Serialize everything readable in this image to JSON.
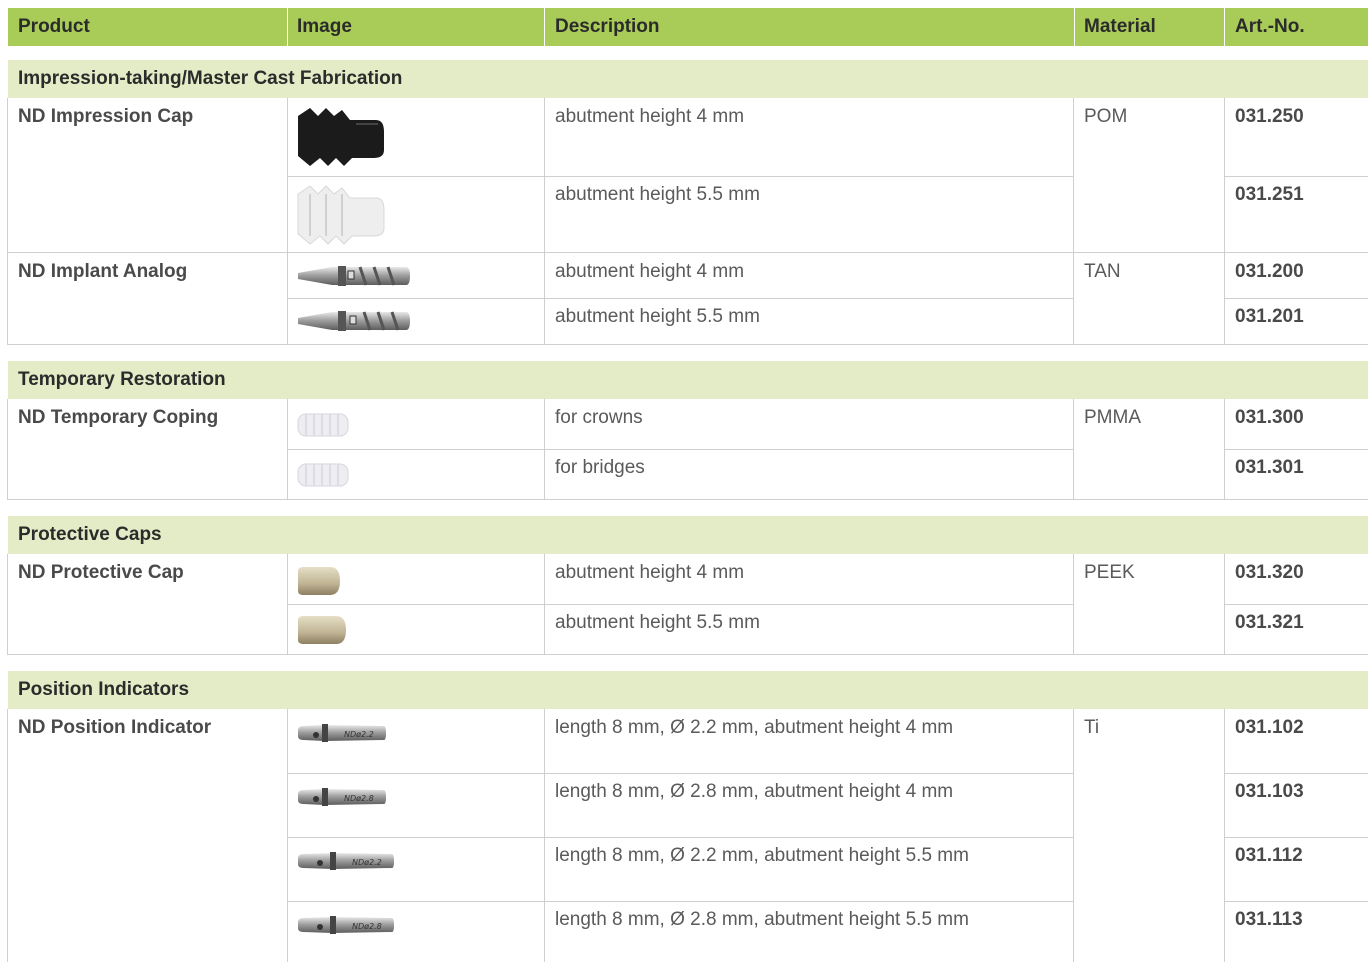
{
  "header": {
    "product": "Product",
    "image": "Image",
    "description": "Description",
    "material": "Material",
    "artno": "Art.-No."
  },
  "sections": [
    {
      "title": "Impression-taking/Master Cast Fabrication",
      "products": [
        {
          "name": "ND Impression Cap",
          "material": "POM",
          "rows": [
            {
              "description": "abutment height 4 mm",
              "art": "031.250",
              "image": "black-impression-cap"
            },
            {
              "description": "abutment height 5.5 mm",
              "art": "031.251",
              "image": "white-impression-cap"
            }
          ]
        },
        {
          "name": "ND Implant Analog",
          "material": "TAN",
          "rows": [
            {
              "description": "abutment height 4 mm",
              "art": "031.200",
              "image": "implant-analog"
            },
            {
              "description": "abutment height 5.5 mm",
              "art": "031.201",
              "image": "implant-analog"
            }
          ]
        }
      ]
    },
    {
      "title": "Temporary Restoration",
      "products": [
        {
          "name": "ND Temporary Coping",
          "material": "PMMA",
          "rows": [
            {
              "description": "for crowns",
              "art": "031.300",
              "image": "temporary-coping"
            },
            {
              "description": "for bridges",
              "art": "031.301",
              "image": "temporary-coping"
            }
          ]
        }
      ]
    },
    {
      "title": "Protective Caps",
      "products": [
        {
          "name": "ND Protective Cap",
          "material": "PEEK",
          "rows": [
            {
              "description": "abutment height 4 mm",
              "art": "031.320",
              "image": "protective-cap"
            },
            {
              "description": "abutment height 5.5 mm",
              "art": "031.321",
              "image": "protective-cap"
            }
          ]
        }
      ]
    },
    {
      "title": "Position Indicators",
      "products": [
        {
          "name": "ND Position Indicator",
          "material": "Ti",
          "rows": [
            {
              "description": "length 8 mm, Ø 2.2 mm, abutment height 4 mm",
              "art": "031.102",
              "image": "position-indicator",
              "engraving": "NDø2.2"
            },
            {
              "description": "length 8 mm, Ø 2.8 mm, abutment height 4 mm",
              "art": "031.103",
              "image": "position-indicator",
              "engraving": "NDø2.8"
            },
            {
              "description": "length 8 mm, Ø 2.2 mm, abutment height 5.5 mm",
              "art": "031.112",
              "image": "position-indicator",
              "engraving": "NDø2.2"
            },
            {
              "description": "length 8 mm, Ø 2.8 mm, abutment height 5.5 mm",
              "art": "031.113",
              "image": "position-indicator",
              "engraving": "NDø2.8"
            }
          ]
        }
      ]
    }
  ],
  "colors": {
    "header_bg": "#a9cc58",
    "section_bg": "#e3ecc6",
    "grid": "#cfcfcf"
  }
}
